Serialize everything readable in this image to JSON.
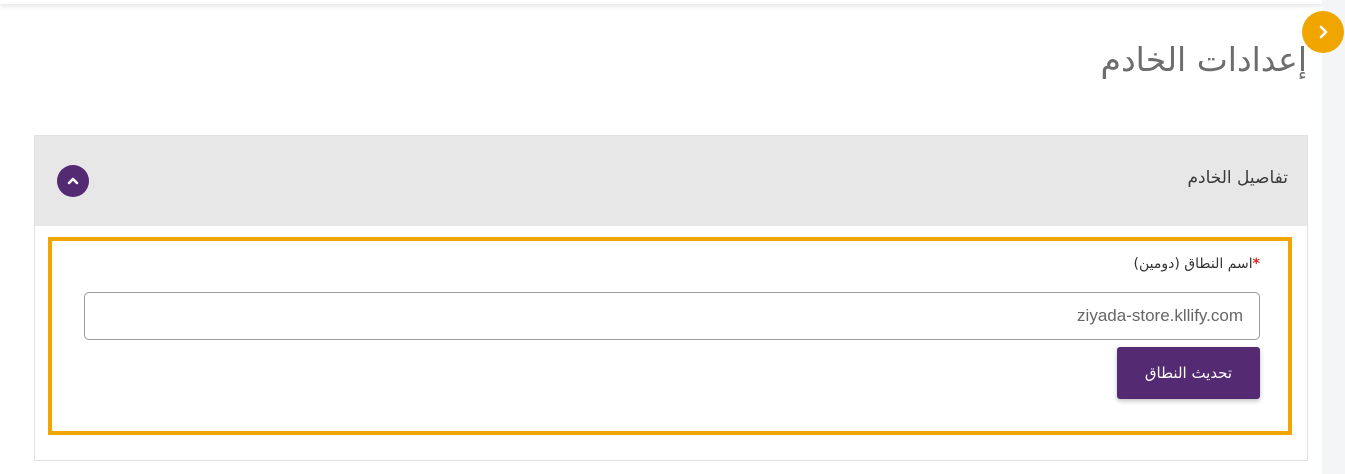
{
  "page": {
    "title": "إعدادات الخادم"
  },
  "sidebar_toggle": {
    "icon": "chevron-right-icon",
    "color": "#f0a500"
  },
  "server_details_card": {
    "title": "تفاصيل الخادم",
    "collapse_icon": "chevron-up-icon",
    "header_background": "#e7e7e7"
  },
  "domain_form": {
    "label": "اسم النطاق (دومين)",
    "required_marker": "*",
    "input_value": "ziyada-store.kllify.com",
    "submit_label": "تحديث النطاق"
  },
  "colors": {
    "primary": "#542a72",
    "highlight": "#f0a500",
    "required": "#e02424"
  }
}
